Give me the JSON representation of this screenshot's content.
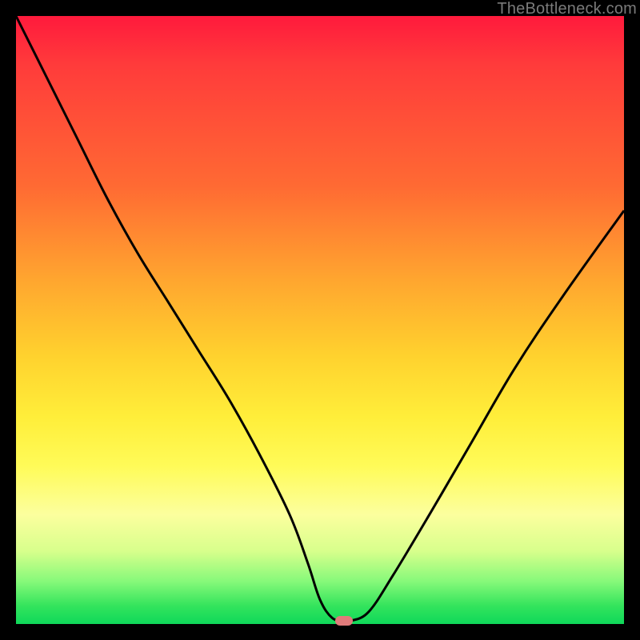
{
  "watermark": "TheBottleneck.com",
  "colors": {
    "curve_stroke": "#000000",
    "marker_fill": "#e07a7a",
    "background": "#000000"
  },
  "chart_data": {
    "type": "line",
    "title": "",
    "xlabel": "",
    "ylabel": "",
    "xlim": [
      0,
      100
    ],
    "ylim": [
      0,
      100
    ],
    "grid": false,
    "series": [
      {
        "name": "bottleneck-curve",
        "x": [
          0,
          5,
          10,
          15,
          20,
          25,
          30,
          35,
          40,
          45,
          48,
          50,
          52,
          54,
          55,
          58,
          62,
          68,
          75,
          82,
          90,
          100
        ],
        "values": [
          100,
          90,
          80,
          70,
          61,
          53,
          45,
          37,
          28,
          18,
          10,
          4,
          1,
          0.5,
          0.5,
          2,
          8,
          18,
          30,
          42,
          54,
          68
        ]
      }
    ],
    "annotations": [
      {
        "name": "min-marker",
        "x": 54,
        "y": 0.5
      }
    ],
    "background_gradient_meaning": "green=good (low bottleneck) → red=bad (high bottleneck)"
  }
}
